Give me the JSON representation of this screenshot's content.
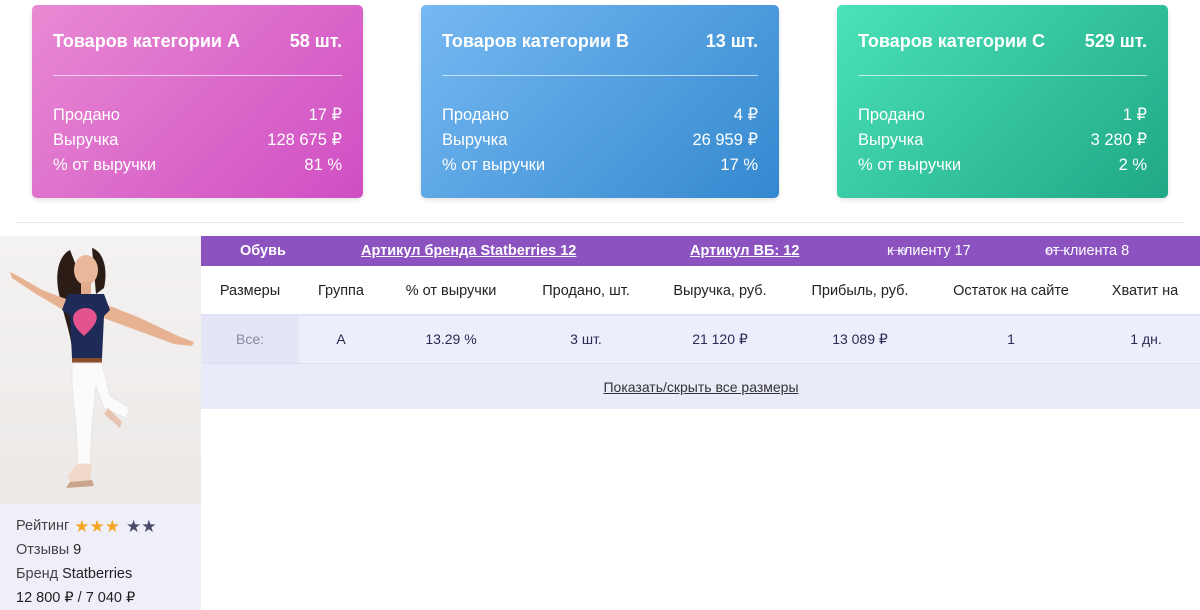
{
  "cards": [
    {
      "title": "Товаров категории A",
      "count": "58 шт.",
      "rows": [
        {
          "label": "Продано",
          "value": "17 ₽"
        },
        {
          "label": "Выручка",
          "value": "128 675 ₽"
        },
        {
          "label": "% от выручки",
          "value": "81 %"
        }
      ]
    },
    {
      "title": "Товаров категории B",
      "count": "13 шт.",
      "rows": [
        {
          "label": "Продано",
          "value": "4 ₽"
        },
        {
          "label": "Выручка",
          "value": "26 959 ₽"
        },
        {
          "label": "% от выручки",
          "value": "17 %"
        }
      ]
    },
    {
      "title": "Товаров категории C",
      "count": "529 шт.",
      "rows": [
        {
          "label": "Продано",
          "value": "1 ₽"
        },
        {
          "label": "Выручка",
          "value": "3 280 ₽"
        },
        {
          "label": "% от выручки",
          "value": "2 %"
        }
      ]
    }
  ],
  "product": {
    "category": "Обувь",
    "brand_article": "Артикул бренда Statberries 12",
    "wb_article": "Артикул ВБ: 12",
    "to_client": "к клиенту 17",
    "from_client": "от клиента 8",
    "rating_label": "Рейтинг",
    "rating": 3,
    "rating_max": 5,
    "reviews_label": "Отзывы",
    "reviews": "9",
    "brand_label": "Бренд",
    "brand": "Statberries",
    "price": "12 800 ₽ / 7 040 ₽"
  },
  "table": {
    "headers": [
      "Размеры",
      "Группа",
      "% от выручки",
      "Продано, шт.",
      "Выручка, руб.",
      "Прибыль, руб.",
      "Остаток на сайте",
      "Хватит на"
    ],
    "rows": [
      [
        "Все:",
        "A",
        "13.29 %",
        "3 шт.",
        "21 120 ₽",
        "13 089 ₽",
        "1",
        "1 дн."
      ]
    ],
    "toggle_label": "Показать/скрыть все размеры"
  },
  "colors": {
    "card_a": "#cf4ec3",
    "card_b": "#3488cf",
    "card_c": "#1fa885",
    "bar": "#8b52c0",
    "star_on": "#f5a623",
    "star_off": "#4a4a6a"
  },
  "icons": {
    "to_client": "arrow-right-icon",
    "from_client": "arrow-left-icon",
    "rating": "star-icon"
  }
}
